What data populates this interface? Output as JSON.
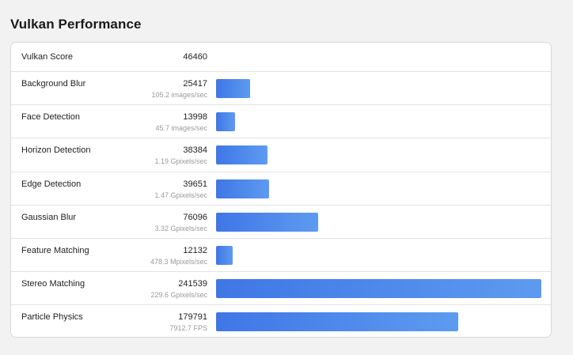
{
  "title": "Vulkan Performance",
  "summary": {
    "label": "Vulkan Score",
    "score": "46460"
  },
  "chart_data": {
    "type": "bar",
    "orientation": "horizontal",
    "title": "Vulkan Performance",
    "xlim": [
      0,
      241539
    ],
    "categories": [
      "Background Blur",
      "Face Detection",
      "Horizon Detection",
      "Edge Detection",
      "Gaussian Blur",
      "Feature Matching",
      "Stereo Matching",
      "Particle Physics"
    ],
    "values": [
      25417,
      13998,
      38384,
      39651,
      76096,
      12132,
      241539,
      179791
    ],
    "score_labels": [
      "25417",
      "13998",
      "38384",
      "39651",
      "76096",
      "12132",
      "241539",
      "179791"
    ],
    "throughput": [
      "105.2 images/sec",
      "45.7 images/sec",
      "1.19 Gpixels/sec",
      "1.47 Gpixels/sec",
      "3.32 Gpixels/sec",
      "478.3 Mpixels/sec",
      "229.6 Gpixels/sec",
      "7912.7 FPS"
    ],
    "bar_color_start": "#3f76e6",
    "bar_color_end": "#5d9bf0"
  }
}
